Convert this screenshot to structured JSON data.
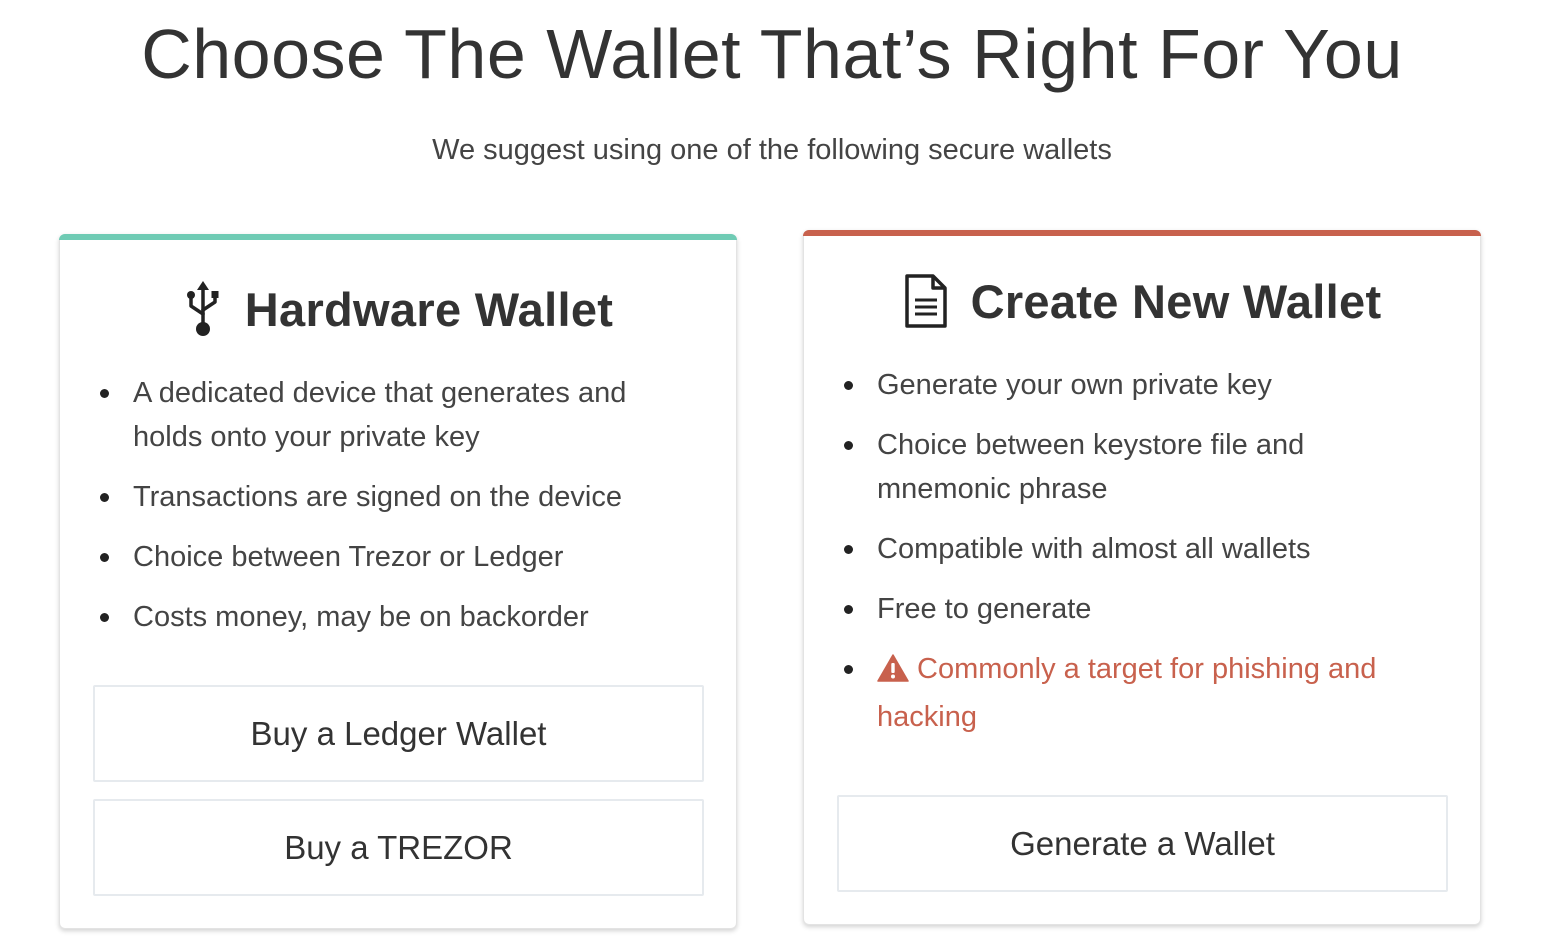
{
  "header": {
    "title": "Choose The Wallet That’s Right For You",
    "subtitle": "We suggest using one of the following secure wallets"
  },
  "hardware_card": {
    "icon": "usb-icon",
    "accent_color": "#6fcbb4",
    "title": "Hardware Wallet",
    "features": [
      "A dedicated device that generates and holds onto your private key",
      "Transactions are signed on the device",
      "Choice between Trezor or Ledger",
      "Costs money, may be on backorder"
    ],
    "buttons": {
      "ledger": "Buy a Ledger Wallet",
      "trezor": "Buy a TREZOR"
    }
  },
  "new_wallet_card": {
    "icon": "document-icon",
    "accent_color": "#c8614d",
    "title": "Create New Wallet",
    "features": [
      "Generate your own private key",
      "Choice between keystore file and mnemonic phrase",
      "Compatible with almost all wallets",
      "Free to generate"
    ],
    "warning": {
      "icon": "warning-icon",
      "text": "Commonly a target for phishing and hacking",
      "color": "#c8614d"
    },
    "buttons": {
      "generate": "Generate a Wallet"
    }
  }
}
